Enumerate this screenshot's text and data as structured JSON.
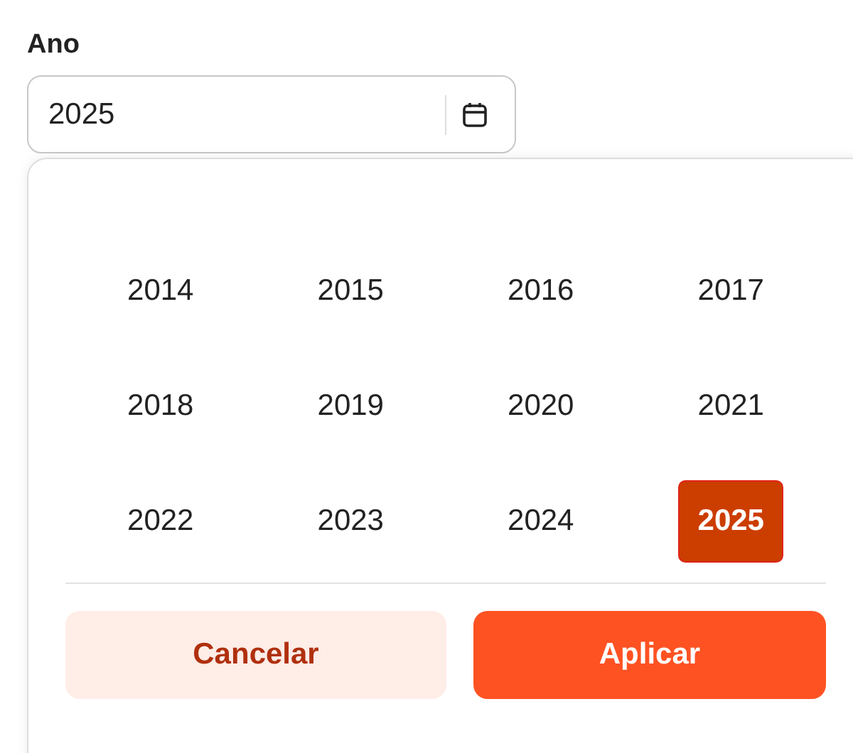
{
  "field": {
    "label": "Ano",
    "value": "2025"
  },
  "years": [
    {
      "label": "2014",
      "selected": false
    },
    {
      "label": "2015",
      "selected": false
    },
    {
      "label": "2016",
      "selected": false
    },
    {
      "label": "2017",
      "selected": false
    },
    {
      "label": "2018",
      "selected": false
    },
    {
      "label": "2019",
      "selected": false
    },
    {
      "label": "2020",
      "selected": false
    },
    {
      "label": "2021",
      "selected": false
    },
    {
      "label": "2022",
      "selected": false
    },
    {
      "label": "2023",
      "selected": false
    },
    {
      "label": "2024",
      "selected": false
    },
    {
      "label": "2025",
      "selected": true
    }
  ],
  "buttons": [
    {
      "label": "Cancelar",
      "kind": "secondary"
    },
    {
      "label": "Aplicar",
      "kind": "primary"
    }
  ]
}
